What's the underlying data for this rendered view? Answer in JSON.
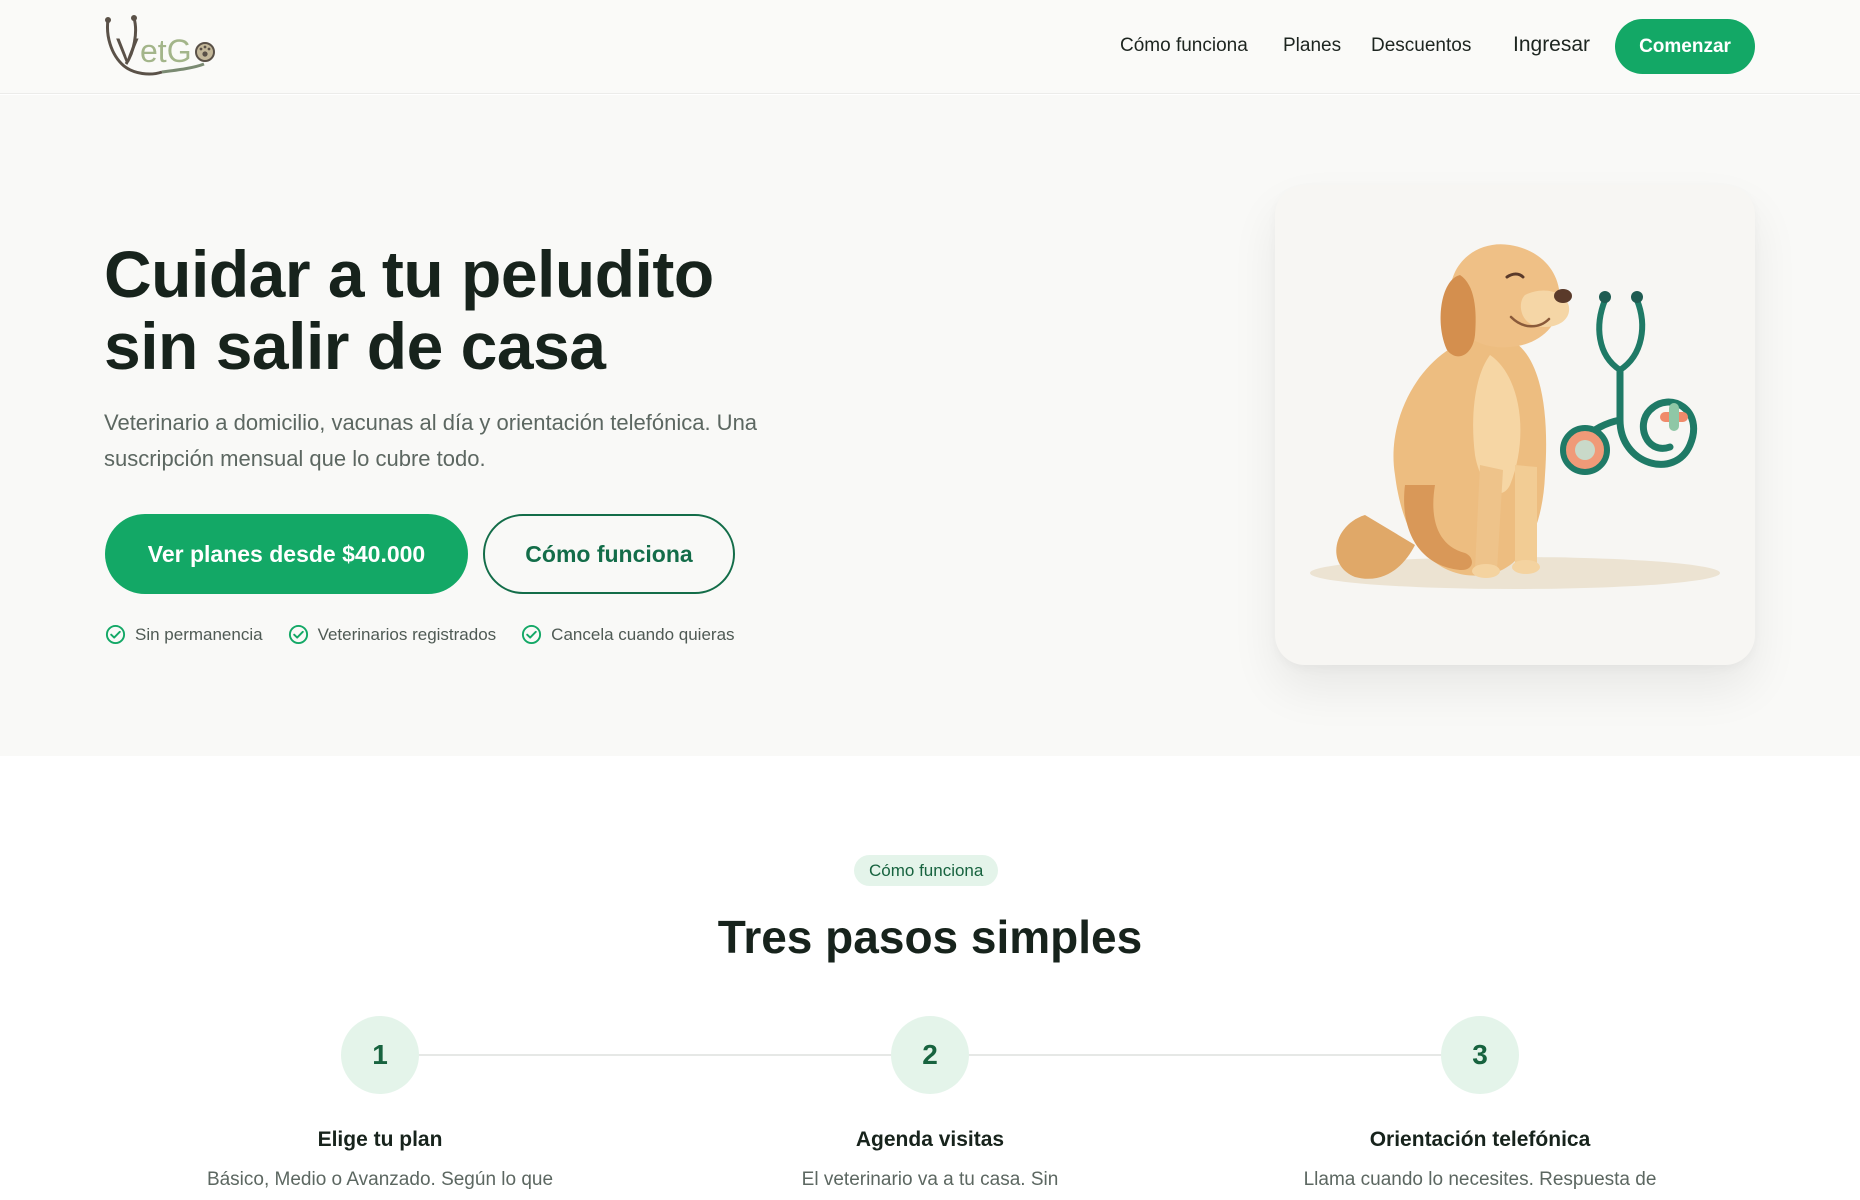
{
  "header": {
    "brand": "VetGo",
    "nav": [
      {
        "label": "Cómo funciona"
      },
      {
        "label": "Planes"
      },
      {
        "label": "Descuentos"
      }
    ],
    "login_label": "Ingresar",
    "cta_label": "Comenzar"
  },
  "hero": {
    "title": "Cuidar a tu peludito sin salir de casa",
    "subtitle": "Veterinario a domicilio, vacunas al día y orientación telefónica. Una suscripción mensual que lo cubre todo.",
    "primary_button": "Ver planes desde $40.000",
    "secondary_button": "Cómo funciona",
    "badges": [
      {
        "label": "Sin permanencia",
        "icon": "check-circle-icon"
      },
      {
        "label": "Veterinarios registrados",
        "icon": "check-circle-icon"
      },
      {
        "label": "Cancela cuando quieras",
        "icon": "check-circle-icon"
      }
    ],
    "illustration": "dog-with-stethoscope"
  },
  "how_it_works": {
    "pill": "Cómo funciona",
    "title": "Tres pasos simples",
    "steps": [
      {
        "number": "1",
        "title": "Elige tu plan",
        "desc": "Básico, Medio o Avanzado. Según lo que"
      },
      {
        "number": "2",
        "title": "Agenda visitas",
        "desc": "El veterinario va a tu casa. Sin"
      },
      {
        "number": "3",
        "title": "Orientación telefónica",
        "desc": "Llama cuando lo necesites. Respuesta de"
      }
    ]
  },
  "colors": {
    "brand_green": "#13a866",
    "dark_green": "#136d49",
    "pill_bg": "#e4f4ea",
    "text_dark": "#17231c"
  }
}
